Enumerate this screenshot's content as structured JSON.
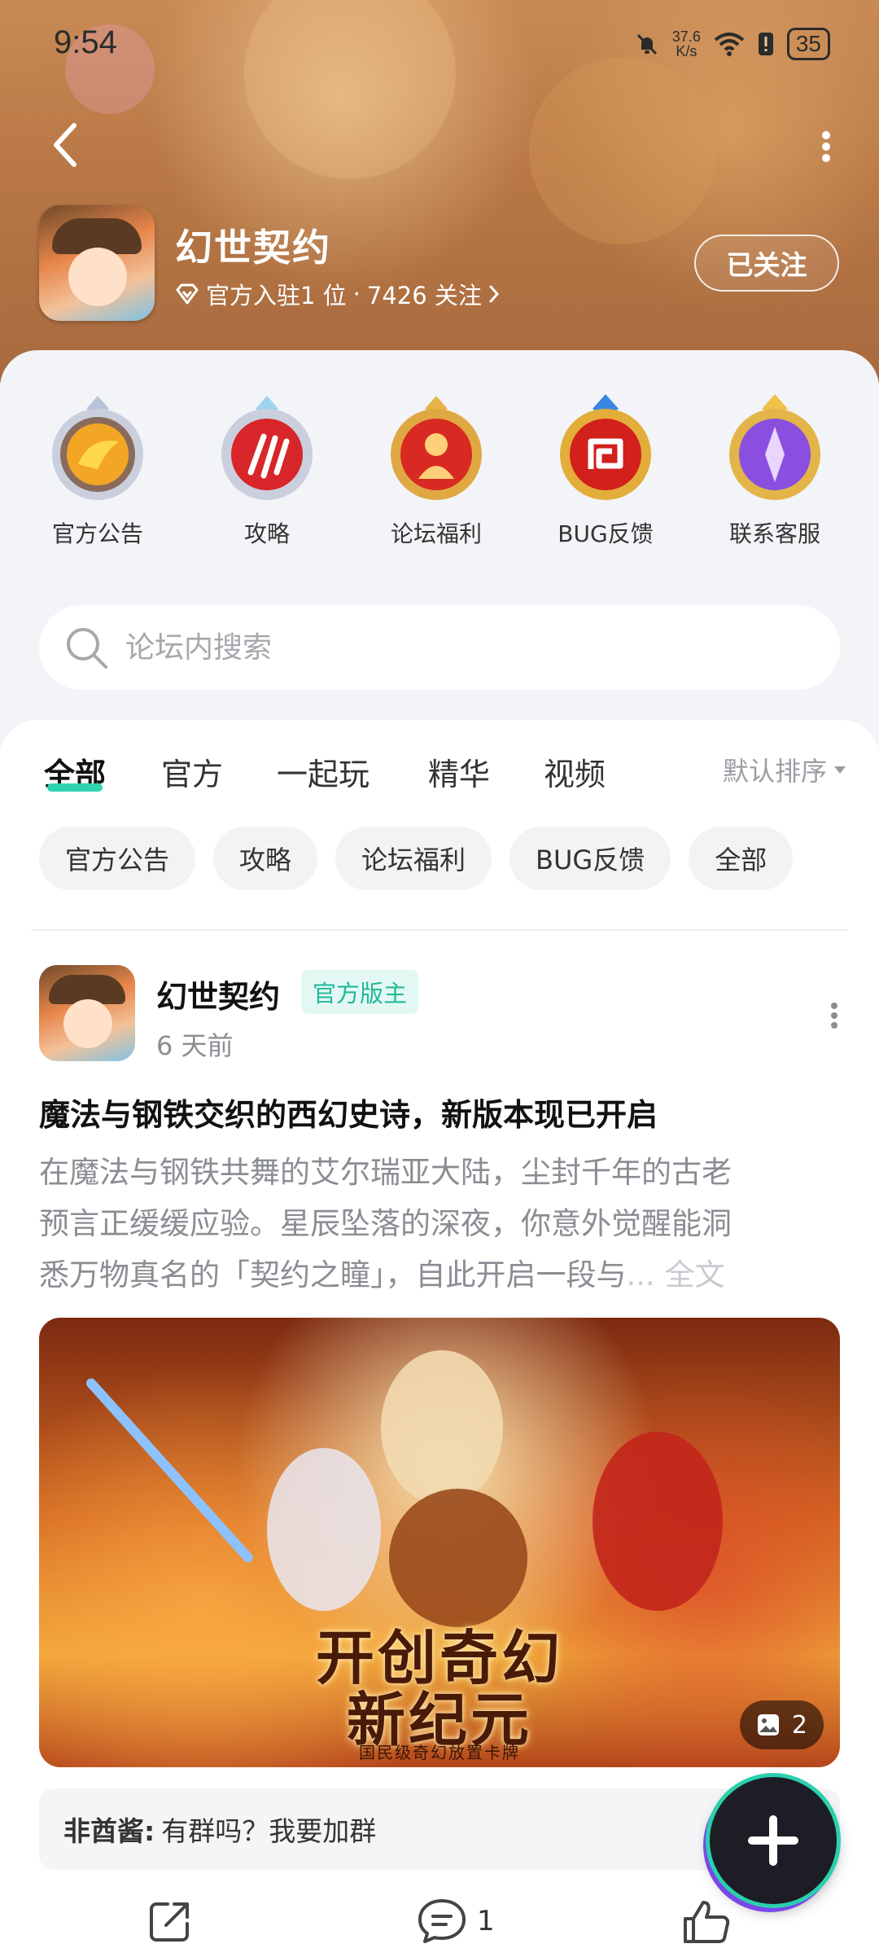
{
  "status_bar": {
    "time": "9:54",
    "net_speed_value": "37.6",
    "net_speed_unit": "K/s",
    "battery": "35"
  },
  "header": {
    "title": "幻世契约",
    "rank": "官方入驻1 位",
    "separator": "·",
    "followers": "7426 关注",
    "follow_button": "已关注"
  },
  "quick_links": [
    {
      "label": "官方公告",
      "icon": "gold-ribbon-badge-icon"
    },
    {
      "label": "攻略",
      "icon": "claw-badge-icon"
    },
    {
      "label": "论坛福利",
      "icon": "figure-badge-icon"
    },
    {
      "label": "BUG反馈",
      "icon": "spiral-badge-icon"
    },
    {
      "label": "联系客服",
      "icon": "purple-crystal-badge-icon"
    }
  ],
  "search": {
    "placeholder": "论坛内搜索"
  },
  "tabs": [
    {
      "label": "全部",
      "active": true
    },
    {
      "label": "官方",
      "active": false
    },
    {
      "label": "一起玩",
      "active": false
    },
    {
      "label": "精华",
      "active": false
    },
    {
      "label": "视频",
      "active": false
    }
  ],
  "sort": {
    "label": "默认排序"
  },
  "chips": [
    "官方公告",
    "攻略",
    "论坛福利",
    "BUG反馈",
    "全部"
  ],
  "post": {
    "author": "幻世契约",
    "tag": "官方版主",
    "time": "6 天前",
    "title": "魔法与钢铁交织的西幻史诗，新版本现已开启",
    "body_lines": [
      "在魔法与钢铁共舞的艾尔瑞亚大陆，尘封千年的古老",
      "预言正缓缓应验。星辰坠落的深夜，你意外觉醒能洞",
      "悉万物真名的「契约之瞳」，自此开启一段与"
    ],
    "ellipsis": "...",
    "more": "全文",
    "image": {
      "title_line1": "开创奇幻",
      "title_line2": "新纪元",
      "subtitle": "国民级奇幻放置卡牌",
      "count": "2"
    },
    "comment": {
      "author": "非酋酱:",
      "text": "有群吗？我要加群"
    },
    "comment_count": "1"
  },
  "colors": {
    "accent": "#2fd3b0",
    "tag_text": "#22b99a",
    "tag_bg": "#e4f8f3",
    "hero_bg": "#b87745",
    "sheet_bg": "#f3f4f7"
  }
}
